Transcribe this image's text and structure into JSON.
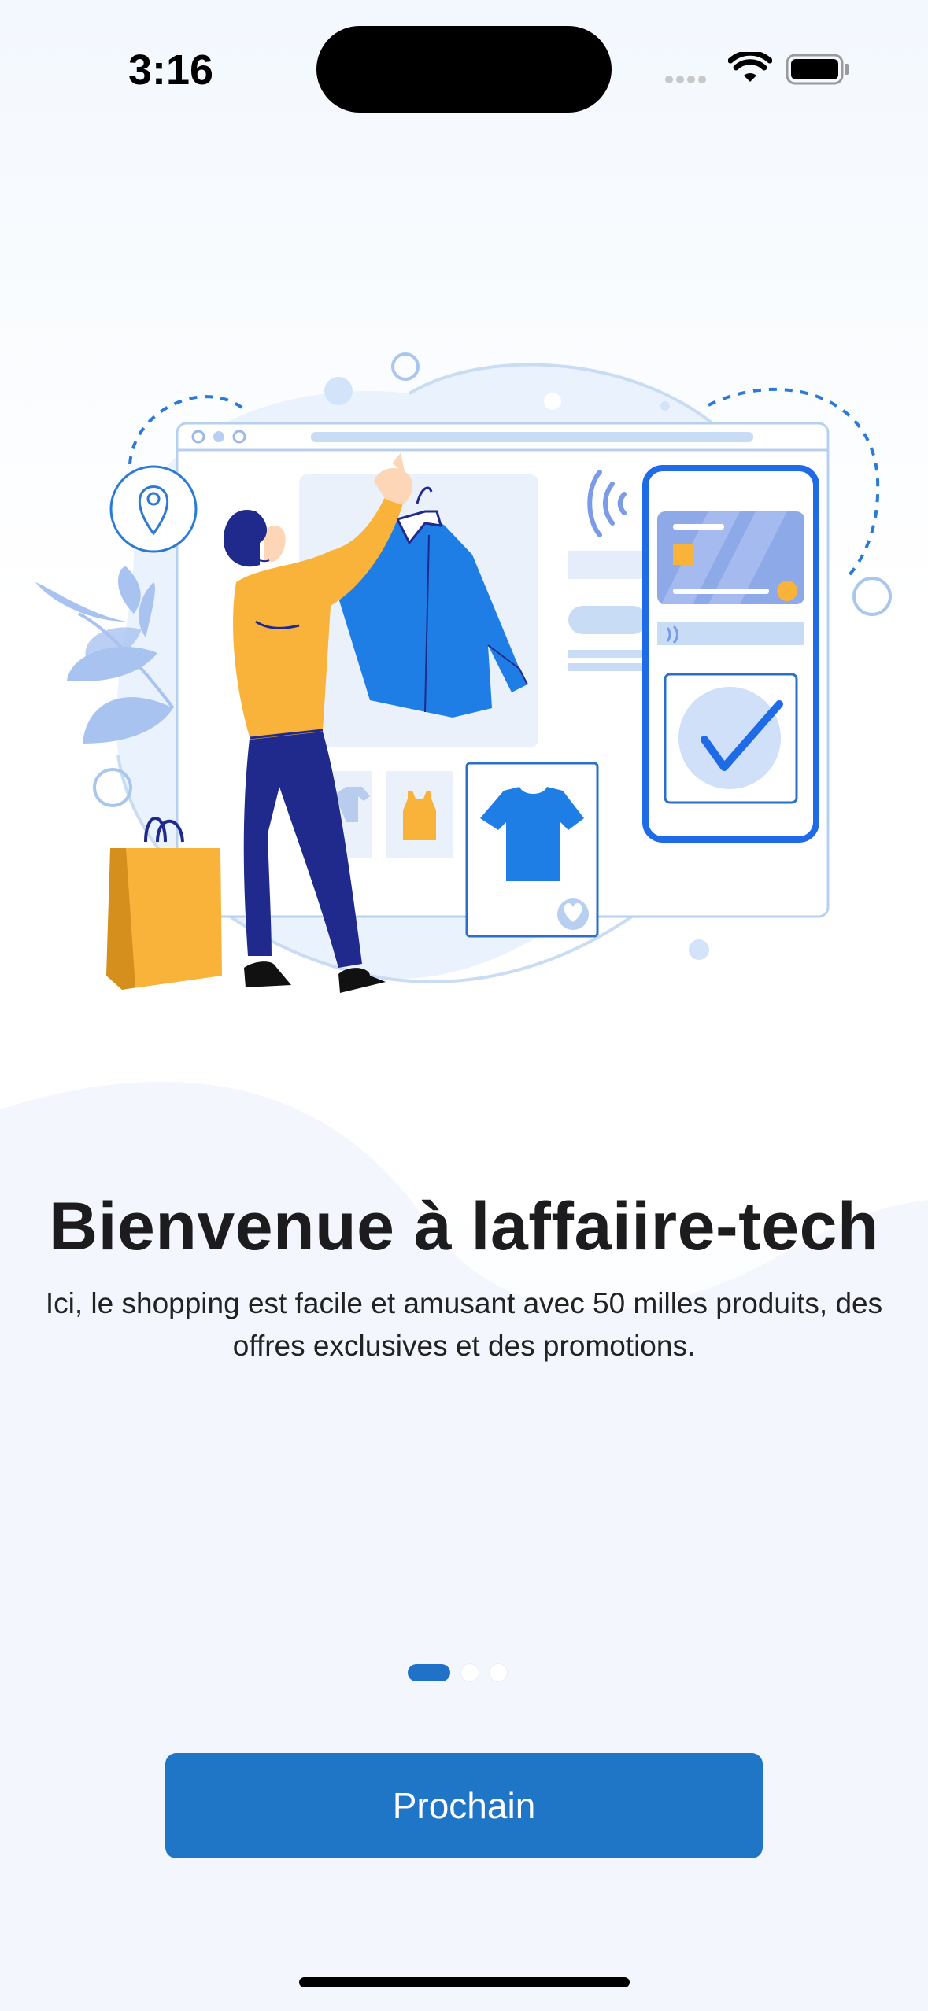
{
  "status_bar": {
    "time": "3:16"
  },
  "welcome": {
    "title": "Bienvenue à laffaiire-tech",
    "subtitle": "Ici, le shopping est facile et amusant avec 50 milles produits, des offres exclusives et des promotions."
  },
  "pagination": {
    "total": 3,
    "active_index": 0
  },
  "actions": {
    "next_label": "Prochain"
  },
  "colors": {
    "accent": "#1f76c6",
    "illustration_blue": "#1f7de6",
    "illustration_orange": "#f9b33a",
    "illustration_navy": "#1f2a8c"
  },
  "icons": [
    "wifi-icon",
    "battery-icon",
    "cellular-signal-icon",
    "location-pin-icon",
    "checkmark-icon",
    "heart-icon",
    "nfc-icon"
  ]
}
